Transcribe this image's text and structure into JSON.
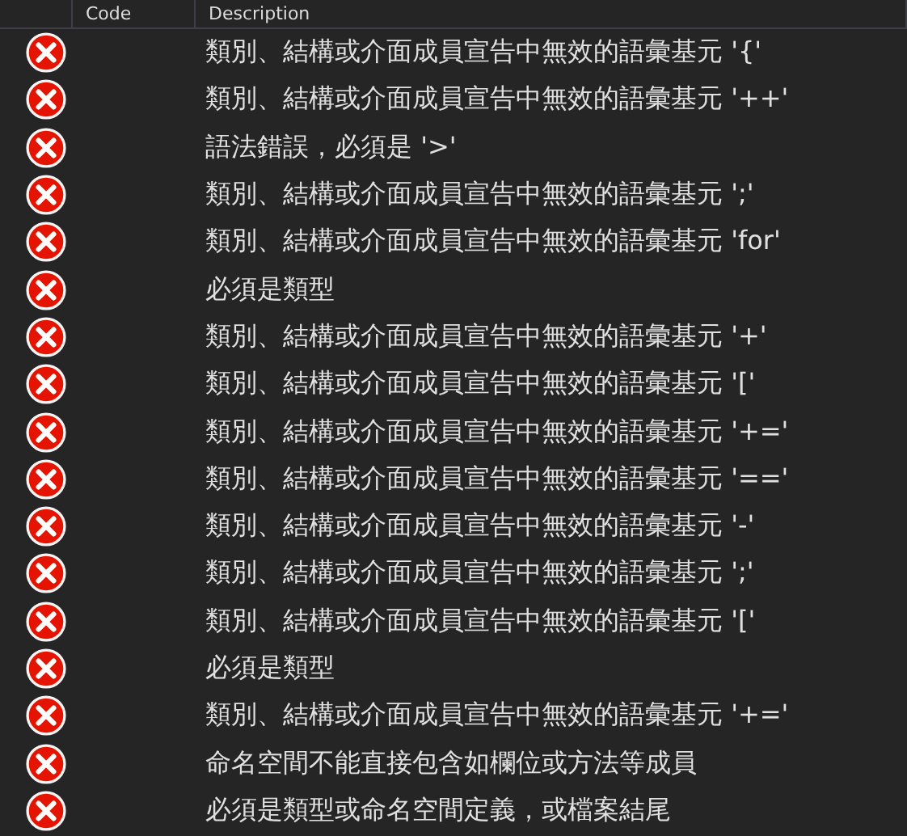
{
  "columns": [
    {},
    {
      "label": "Code"
    },
    {
      "label": "Description"
    }
  ],
  "rows": [
    {
      "kind": "error",
      "description": "類別、結構或介面成員宣告中無效的語彙基元 '{'"
    },
    {
      "kind": "error",
      "description": "類別、結構或介面成員宣告中無效的語彙基元 '++'"
    },
    {
      "kind": "error",
      "description": "語法錯誤，必須是 '>'"
    },
    {
      "kind": "error",
      "description": "類別、結構或介面成員宣告中無效的語彙基元 ';'"
    },
    {
      "kind": "error",
      "description": "類別、結構或介面成員宣告中無效的語彙基元 'for'"
    },
    {
      "kind": "error",
      "description": "必須是類型"
    },
    {
      "kind": "error",
      "description": "類別、結構或介面成員宣告中無效的語彙基元 '+'"
    },
    {
      "kind": "error",
      "description": "類別、結構或介面成員宣告中無效的語彙基元 '['"
    },
    {
      "kind": "error",
      "description": "類別、結構或介面成員宣告中無效的語彙基元 '+='"
    },
    {
      "kind": "error",
      "description": "類別、結構或介面成員宣告中無效的語彙基元 '=='"
    },
    {
      "kind": "error",
      "description": "類別、結構或介面成員宣告中無效的語彙基元 '-'"
    },
    {
      "kind": "error",
      "description": "類別、結構或介面成員宣告中無效的語彙基元 ';'"
    },
    {
      "kind": "error",
      "description": "類別、結構或介面成員宣告中無效的語彙基元 '['"
    },
    {
      "kind": "error",
      "description": "必須是類型"
    },
    {
      "kind": "error",
      "description": "類別、結構或介面成員宣告中無效的語彙基元 '+='"
    },
    {
      "kind": "error",
      "description": "命名空間不能直接包含如欄位或方法等成員"
    },
    {
      "kind": "error",
      "description": "必須是類型或命名空間定義，或檔案結尾"
    }
  ]
}
